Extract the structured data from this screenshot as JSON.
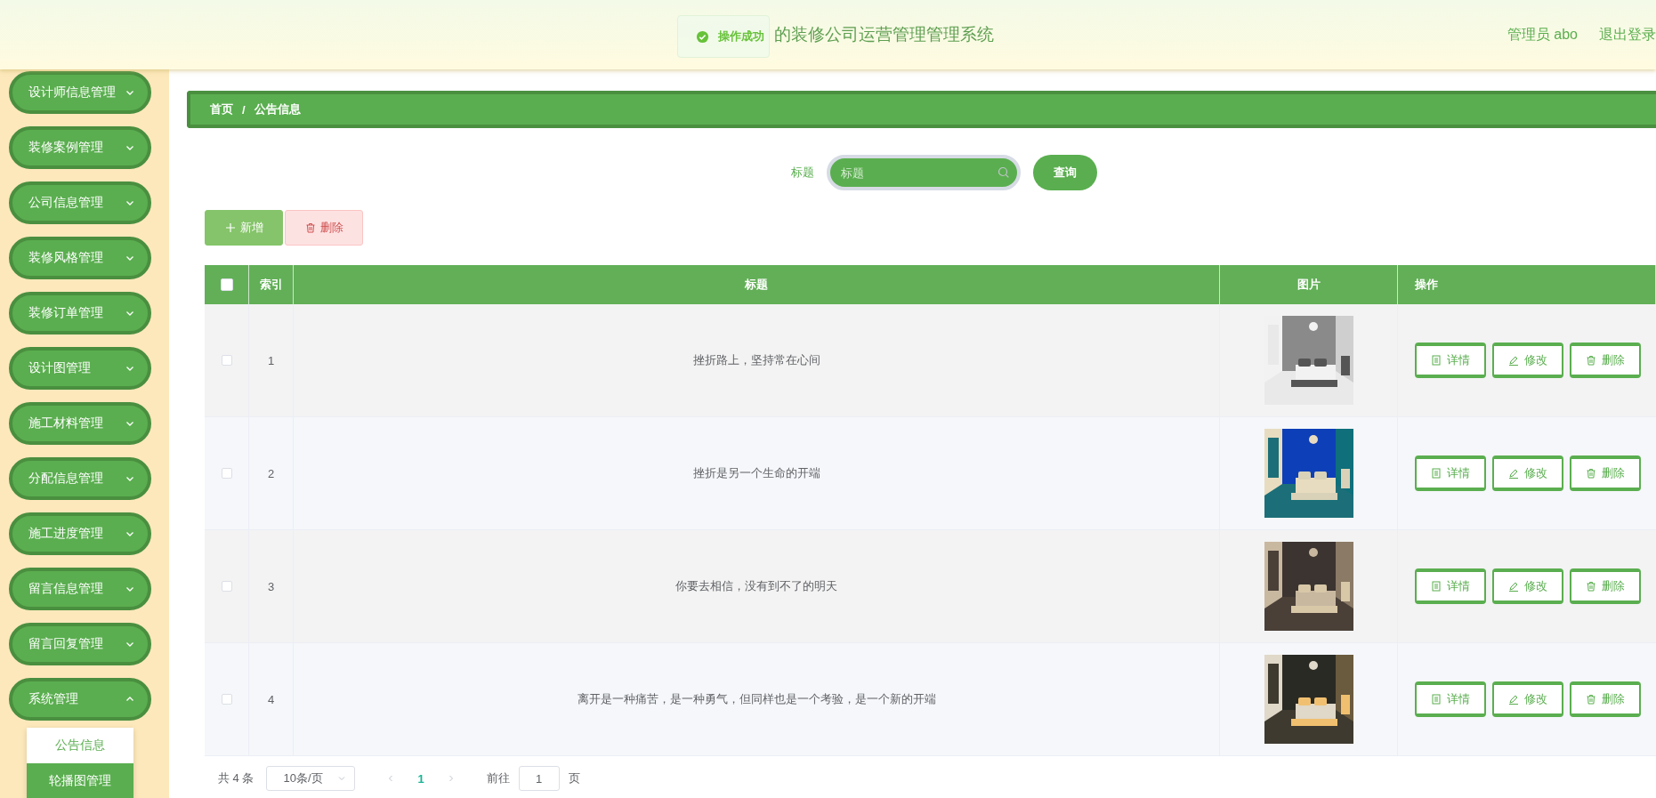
{
  "header": {
    "title": "的装修公司运营管理管理系统",
    "user": "管理员 abo",
    "logout": "退出登录"
  },
  "toast": {
    "text": "操作成功"
  },
  "sidebar": {
    "items": [
      {
        "label": "设计师信息管理",
        "expanded": false
      },
      {
        "label": "装修案例管理",
        "expanded": false
      },
      {
        "label": "公司信息管理",
        "expanded": false
      },
      {
        "label": "装修风格管理",
        "expanded": false
      },
      {
        "label": "装修订单管理",
        "expanded": false
      },
      {
        "label": "设计图管理",
        "expanded": false
      },
      {
        "label": "施工材料管理",
        "expanded": false
      },
      {
        "label": "分配信息管理",
        "expanded": false
      },
      {
        "label": "施工进度管理",
        "expanded": false
      },
      {
        "label": "留言信息管理",
        "expanded": false
      },
      {
        "label": "留言回复管理",
        "expanded": false
      },
      {
        "label": "系统管理",
        "expanded": true,
        "children": [
          {
            "label": "公告信息",
            "selected": true
          },
          {
            "label": "轮播图管理",
            "selected": false
          }
        ]
      }
    ]
  },
  "breadcrumb": {
    "items": [
      "首页",
      "公告信息"
    ],
    "separator": "/"
  },
  "search": {
    "label": "标题",
    "placeholder": "标题",
    "button": "查询"
  },
  "actions": [
    {
      "label": "新增",
      "kind": "add",
      "disabled": false
    },
    {
      "label": "删除",
      "kind": "delete",
      "disabled": true
    }
  ],
  "table": {
    "all_checked": false,
    "columns": [
      "索引",
      "标题",
      "图片",
      "操作"
    ],
    "rows": [
      {
        "checked": false,
        "index": "1",
        "title": "挫折路上，坚持常在心间",
        "image": {
          "kind": "picture"
        },
        "buttons": [
          "详情",
          "修改",
          "删除"
        ]
      },
      {
        "checked": false,
        "index": "2",
        "title": "挫折是另一个生命的开端",
        "image": {
          "kind": "picture"
        },
        "buttons": [
          "详情",
          "修改",
          "删除"
        ]
      },
      {
        "checked": false,
        "index": "3",
        "title": "你要去相信，没有到不了的明天",
        "image": {
          "kind": "picture"
        },
        "buttons": [
          "详情",
          "修改",
          "删除"
        ]
      },
      {
        "checked": false,
        "index": "4",
        "title": "离开是一种痛苦，是一种勇气，但同样也是一个考验，是一个新的开端",
        "image": {
          "kind": "picture"
        },
        "buttons": [
          "详情",
          "修改",
          "删除"
        ]
      }
    ]
  },
  "pagination": {
    "total": "共 4 条",
    "page_size": "10条/页",
    "pages": [
      {
        "label": "1",
        "selected": true
      }
    ],
    "goto_label": "前往",
    "goto_value": "1",
    "goto_suffix": "页"
  }
}
